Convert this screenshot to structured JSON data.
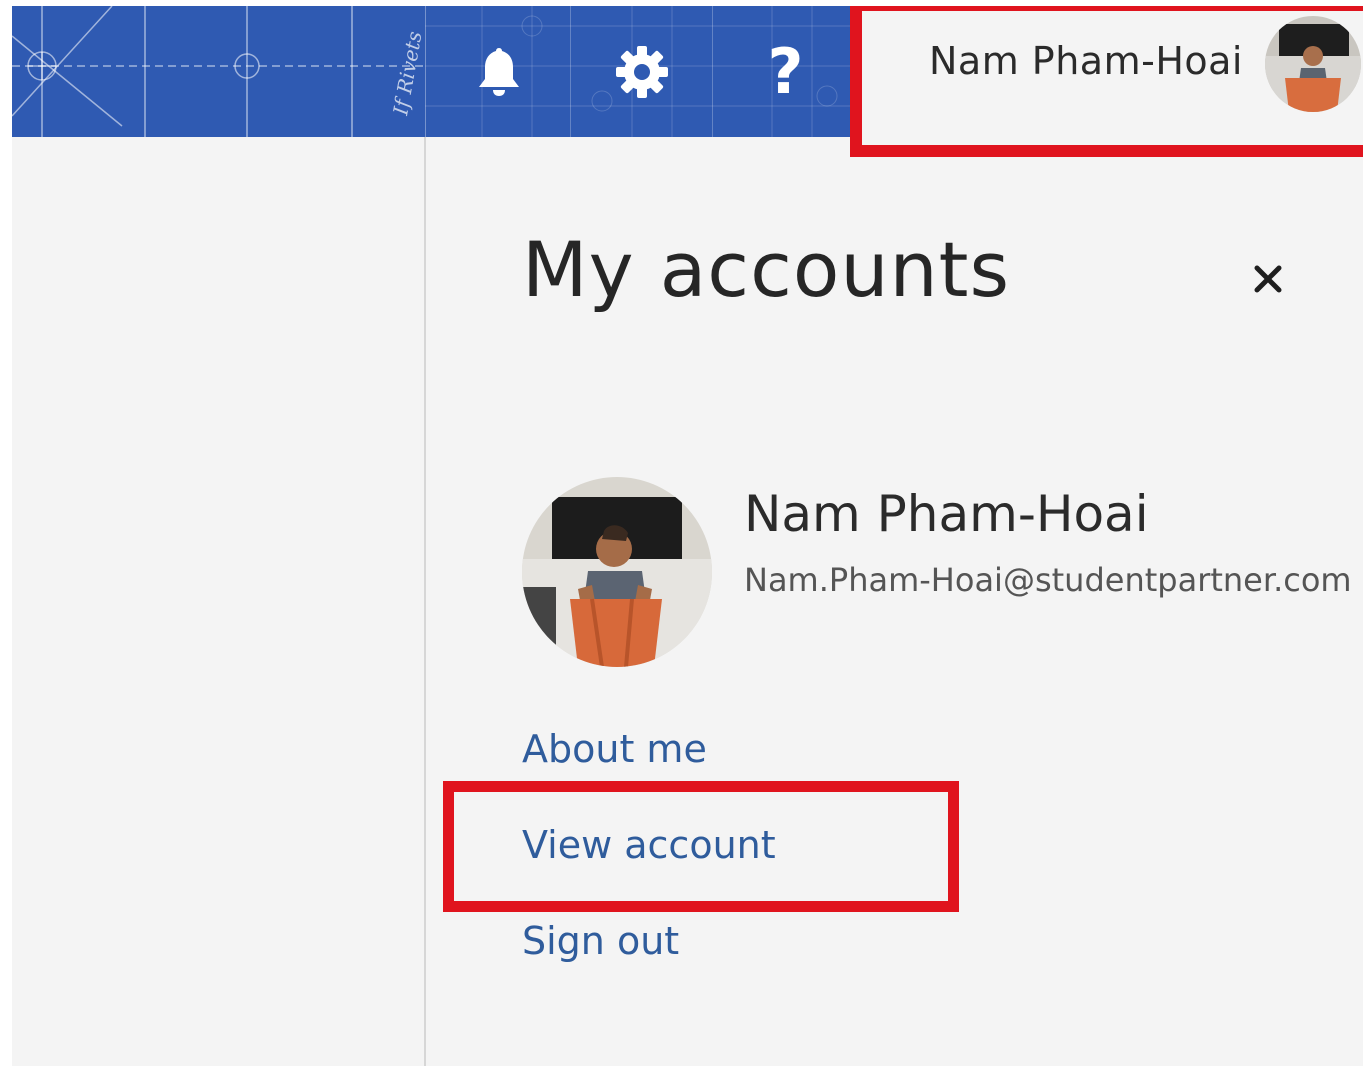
{
  "header": {
    "notifications_icon": "bell-icon",
    "settings_icon": "gear-icon",
    "help_glyph": "?",
    "account_name": "Nam Pham-Hoai",
    "background_color": "#2f5ab2"
  },
  "panel": {
    "title": "My accounts",
    "close_glyph": "×",
    "profile": {
      "name": "Nam Pham-Hoai",
      "email": "Nam.Pham-Hoai@studentpartner.com"
    },
    "links": {
      "about_me": "About me",
      "view_account": "View account",
      "sign_out": "Sign out"
    }
  },
  "colors": {
    "highlight": "#e0141e",
    "link": "#2f5c9c",
    "panel_bg": "#f4f4f4"
  }
}
